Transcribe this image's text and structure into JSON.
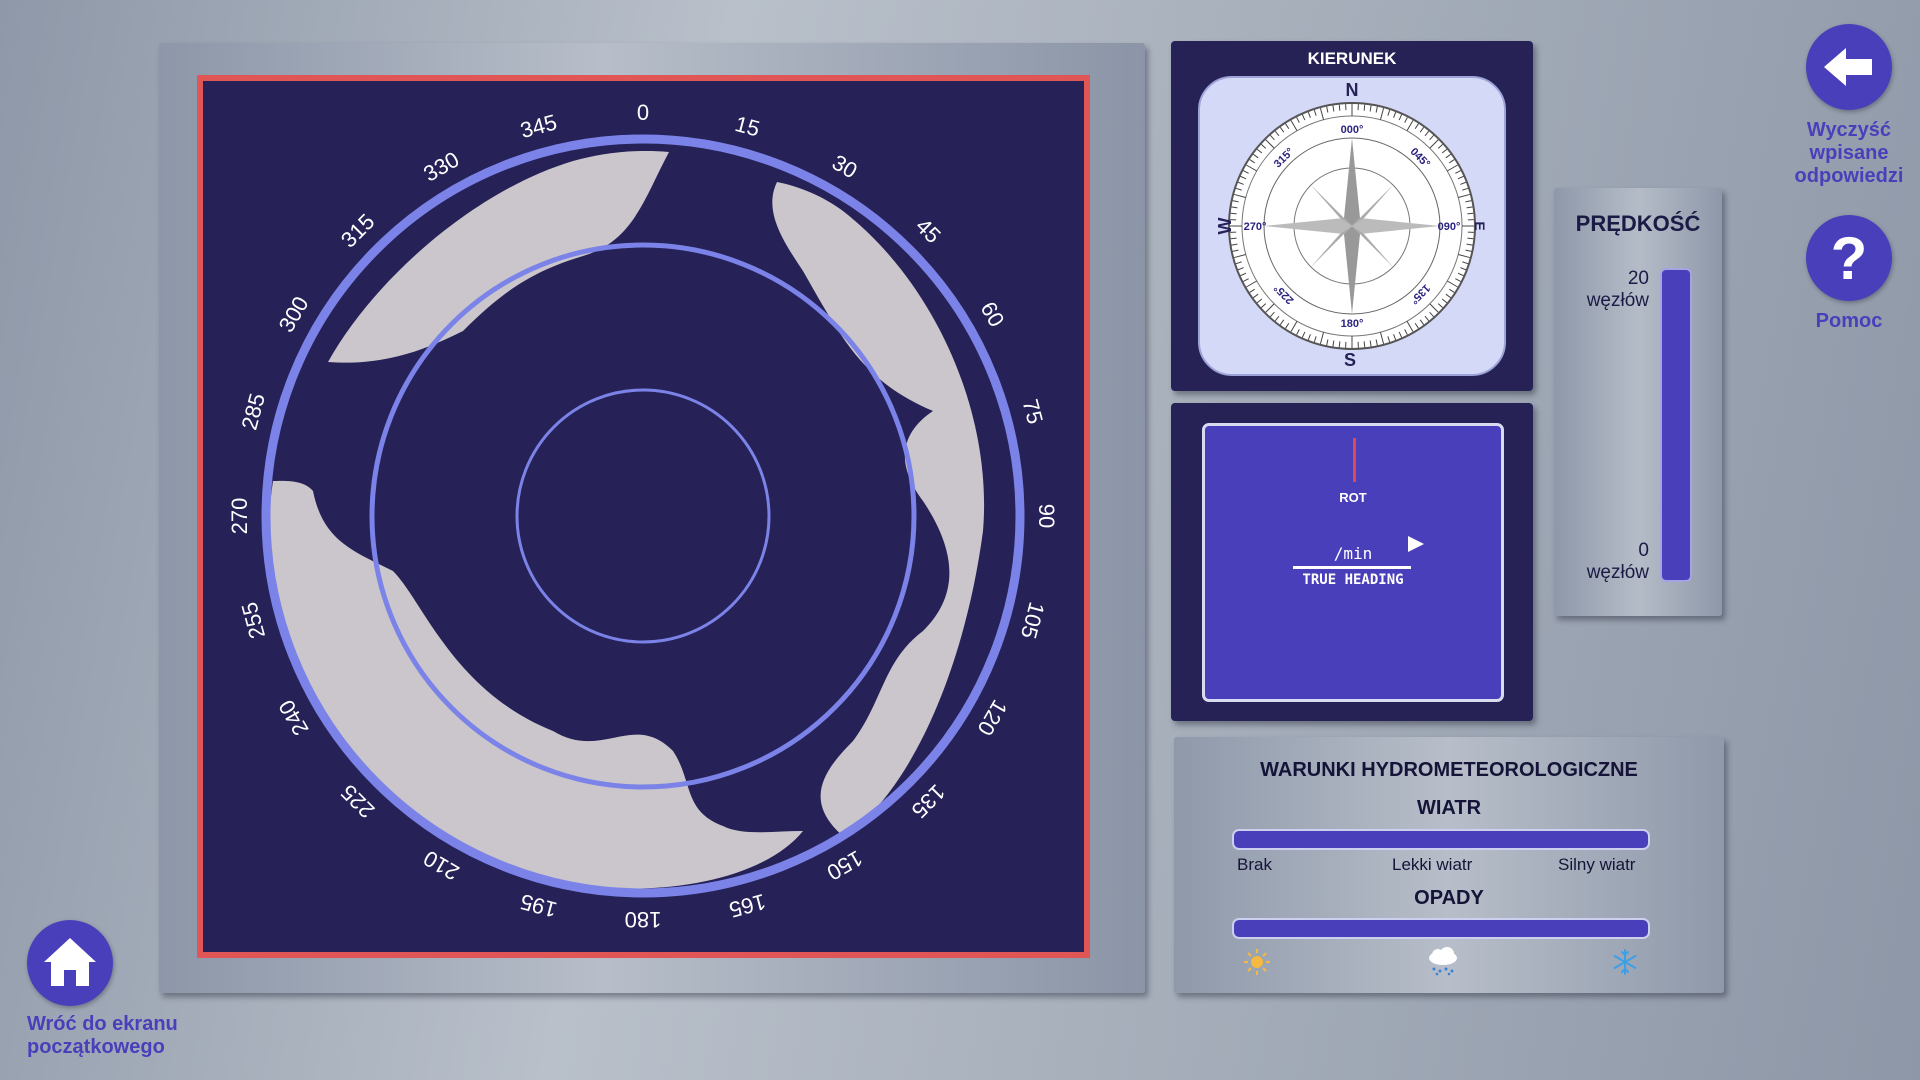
{
  "radar": {
    "bearings": [
      "0",
      "15",
      "30",
      "45",
      "60",
      "75",
      "90",
      "105",
      "120",
      "135",
      "150",
      "165",
      "180",
      "195",
      "210",
      "225",
      "240",
      "255",
      "270",
      "285",
      "300",
      "315",
      "330",
      "345"
    ],
    "colors": {
      "frame": "#e05555",
      "water": "#262157",
      "land": "#cbc6cb",
      "rings": "#7b83e8"
    }
  },
  "compass": {
    "title": "KIERUNEK",
    "cardinals": {
      "n": "N",
      "e": "E",
      "s": "S",
      "w": "W"
    },
    "degrees": [
      "000°",
      "045°",
      "090°",
      "135°",
      "180°",
      "225°",
      "270°",
      "315°"
    ]
  },
  "heading": {
    "rot_label": "ROT",
    "rate_unit": "/min",
    "true_heading": "TRUE HEADING"
  },
  "speed": {
    "title": "PRĘDKOŚĆ",
    "max_value": "20",
    "max_unit": "węzłów",
    "min_value": "0",
    "min_unit": "węzłów"
  },
  "weather": {
    "title": "WARUNKI HYDROMETEOROLOGICZNE",
    "wind_title": "WIATR",
    "wind_labels": [
      "Brak",
      "Lekki wiatr",
      "Silny wiatr"
    ],
    "precip_title": "OPADY",
    "precip_icons": [
      "sun-icon",
      "rain-cloud-icon",
      "snowflake-icon"
    ]
  },
  "buttons": {
    "clear_label": "Wyczyść wpisane odpowiedzi",
    "help_label": "Pomoc",
    "home_label": "Wróć do ekranu początkowego"
  },
  "accent": "#4a3fbb"
}
